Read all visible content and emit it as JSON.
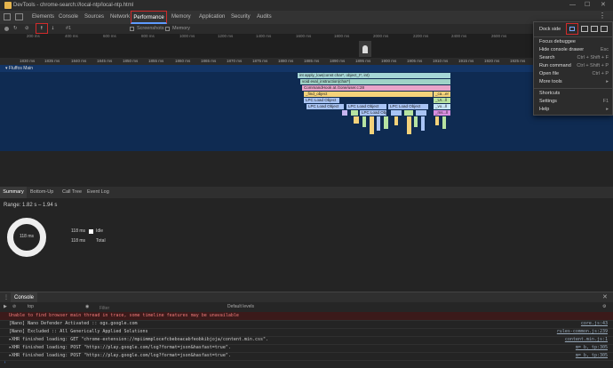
{
  "window": {
    "title": "DevTools - chrome-search://local-ntp/local-ntp.html",
    "controls": [
      "—",
      "☐",
      "✕"
    ]
  },
  "tabs": [
    "Elements",
    "Console",
    "Sources",
    "Network",
    "Performance",
    "Memory",
    "Application",
    "Security",
    "Audits"
  ],
  "toolbar": {
    "record": "record-icon",
    "reload": "reload-icon",
    "clear": "clear-icon",
    "upload": "upload-icon",
    "download": "download-icon",
    "profile_select": "#1",
    "screenshots": "Screenshots",
    "memory": "Memory"
  },
  "overview_ticks": [
    "200 ms",
    "400 ms",
    "600 ms",
    "800 ms",
    "1000 ms",
    "1200 ms",
    "1400 ms",
    "1600 ms",
    "1800 ms",
    "2000 ms",
    "2200 ms",
    "2400 ms",
    "2600 ms"
  ],
  "timeline_ticks": [
    "1830 ms",
    "1835 ms",
    "1840 ms",
    "1845 ms",
    "1850 ms",
    "1855 ms",
    "1860 ms",
    "1865 ms",
    "1870 ms",
    "1875 ms",
    "1880 ms",
    "1885 ms",
    "1890 ms",
    "1895 ms",
    "1900 ms",
    "1905 ms",
    "1910 ms",
    "1915 ms",
    "1920 ms",
    "1925 ms"
  ],
  "main_track": "Fluffos Main",
  "flame": [
    "int apply_low(const char*, object_t*, int)",
    "void eval_instruction(char*)",
    "CommandHook at /zone/user.c:28",
    "_find_object",
    "_ca...er",
    "LPC Load Object",
    "LPC Load Object",
    "LPC Load Object",
    "LPC Load Object",
    "LPC Load Object",
    "_Ur...ll",
    "_vo...ll",
    "_ms...ll"
  ],
  "bottom_tabs": [
    "Summary",
    "Bottom-Up",
    "Call Tree",
    "Event Log"
  ],
  "summary": {
    "range": "Range: 1.82 s – 1.94 s",
    "center": "118 ms",
    "rows": [
      {
        "value": "118 ms",
        "label": "Idle"
      },
      {
        "value": "118 ms",
        "label": "Total"
      }
    ]
  },
  "console": {
    "tab": "Console",
    "context": "top",
    "filter_placeholder": "Filter",
    "levels": "Default levels",
    "lines": [
      {
        "text": "Unable to find browser main thread in trace, some timeline features may be unavailable",
        "src": "",
        "error": true
      },
      {
        "text": "[Nano] Nano Defender Activated :: ogs.google.com",
        "src": "core.js:43",
        "error": false
      },
      {
        "text": "[Nano] Excluded :: All Generically Applied Solutions",
        "src": "rules-common.js:239",
        "error": false
      },
      {
        "text": "▸XHR finished loading: GET \"chrome-extension://mpiimmplocefcbeboacabfeobkibjoja/content.min.css\".",
        "src": "content.min.js:1",
        "error": false
      },
      {
        "text": "▸XHR finished loading: POST \"https://play.google.com/log?format=json&hasfast=true\".",
        "src": "m=_b,_tp:305",
        "error": false
      },
      {
        "text": "▸XHR finished loading: POST \"https://play.google.com/log?format=json&hasfast=true\".",
        "src": "m=_b,_tp:305",
        "error": false
      }
    ]
  },
  "menu": {
    "dock_side": "Dock side",
    "items": [
      {
        "label": "Focus debuggee",
        "shortcut": ""
      },
      {
        "label": "Hide console drawer",
        "shortcut": "Esc"
      },
      {
        "label": "Search",
        "shortcut": "Ctrl + Shift + F"
      },
      {
        "label": "Run command",
        "shortcut": "Ctrl + Shift + P"
      },
      {
        "label": "Open file",
        "shortcut": "Ctrl + P"
      },
      {
        "label": "More tools",
        "shortcut": "▸"
      }
    ],
    "items2": [
      {
        "label": "Shortcuts",
        "shortcut": ""
      },
      {
        "label": "Settings",
        "shortcut": "F1"
      },
      {
        "label": "Help",
        "shortcut": "▸"
      }
    ]
  }
}
